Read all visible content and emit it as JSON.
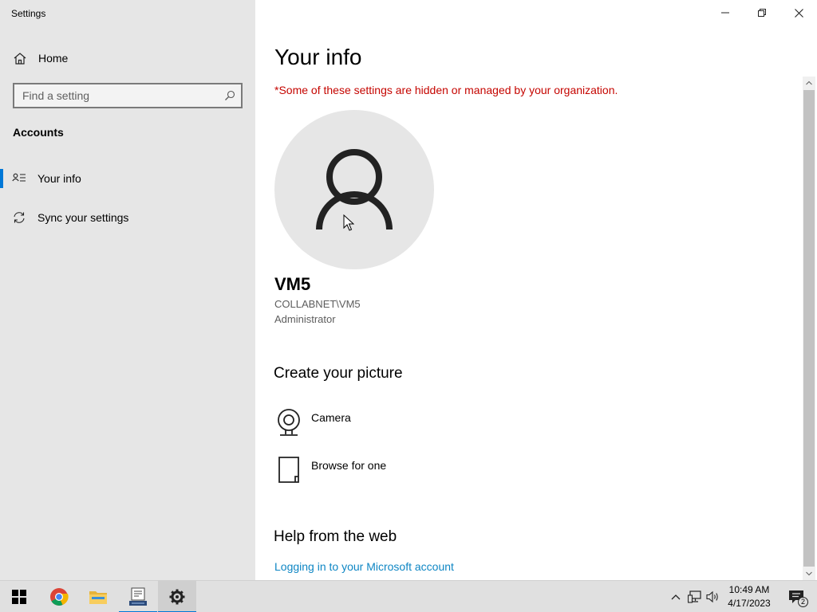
{
  "window": {
    "title": "Settings"
  },
  "sidebar": {
    "home_label": "Home",
    "search_placeholder": "Find a setting",
    "section_title": "Accounts",
    "items": [
      {
        "label": "Your info",
        "icon": "person-list-icon",
        "selected": true
      },
      {
        "label": "Sync your settings",
        "icon": "sync-icon",
        "selected": false
      }
    ]
  },
  "main": {
    "title": "Your info",
    "org_note": "*Some of these settings are hidden or managed by your organization.",
    "user": {
      "name": "VM5",
      "domain": "COLLABNET\\VM5",
      "role": "Administrator"
    },
    "create_picture": {
      "heading": "Create your picture",
      "options": [
        {
          "label": "Camera",
          "icon": "camera-icon"
        },
        {
          "label": "Browse for one",
          "icon": "document-icon"
        }
      ]
    },
    "help": {
      "heading": "Help from the web",
      "link": "Logging in to your Microsoft account"
    }
  },
  "taskbar": {
    "apps": [
      "start-icon",
      "chrome-icon",
      "file-explorer-icon",
      "app-icon",
      "settings-gear-icon"
    ],
    "active_app": "settings-gear-icon",
    "time": "10:49 AM",
    "date": "4/17/2023",
    "notification_count": "2"
  },
  "colors": {
    "sidebar_bg": "#e6e6e6",
    "accent": "#0078d7",
    "warning_text": "#c50500",
    "link": "#0e86c4"
  }
}
